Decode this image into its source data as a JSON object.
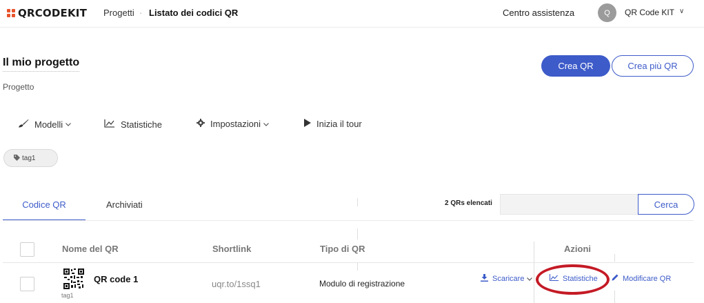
{
  "header": {
    "logo_text": "QRCODEKIT",
    "breadcrumb_projects": "Progetti",
    "breadcrumb_separator": "·",
    "breadcrumb_current": "Listato dei codici QR",
    "help_link": "Centro assistenza",
    "avatar_initial": "Q",
    "account_name": "QR Code KIT",
    "account_chevron": "∨",
    "logo_color": "#e8532b"
  },
  "project": {
    "title": "Il mio progetto",
    "subtitle": "Progetto",
    "create_button": "Crea QR",
    "create_multiple_button": "Crea più QR",
    "accent_color": "#3d5bc9"
  },
  "toolbar": {
    "models": {
      "label": "Modelli",
      "icon": "brush-icon"
    },
    "statistics": {
      "label": "Statistiche",
      "icon": "chart-line-icon"
    },
    "settings": {
      "label": "Impostazioni",
      "icon": "gear-icon"
    },
    "tour": {
      "label": "Inizia il tour",
      "icon": "play-icon"
    }
  },
  "tag_filter": {
    "label": "tag1"
  },
  "tabs": [
    {
      "label": "Codice QR",
      "active": true
    },
    {
      "label": "Archiviati",
      "active": false
    }
  ],
  "list": {
    "count_label": "2 QRs elencati",
    "search_placeholder": "",
    "search_button": "Cerca"
  },
  "table": {
    "columns": {
      "name": "Nome del QR",
      "shortlink": "Shortlink",
      "type": "Tipo di QR",
      "actions": "Azioni"
    },
    "rows": [
      {
        "name": "QR code 1",
        "tag": "tag1",
        "shortlink": "uqr.to/1ssq1",
        "type": "Modulo di registrazione",
        "actions": {
          "download": "Scaricare",
          "statistics": "Statistiche",
          "edit": "Modificare QR"
        }
      }
    ]
  },
  "annotation": {
    "highlight_color": "#c41a25"
  }
}
